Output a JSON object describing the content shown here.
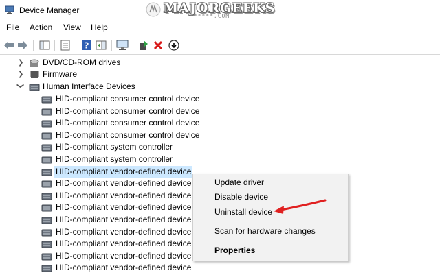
{
  "window": {
    "title": "Device Manager"
  },
  "watermark": {
    "text": "MAJORGEEKS",
    "sub": "******.COM"
  },
  "menu": [
    {
      "label": "File"
    },
    {
      "label": "Action"
    },
    {
      "label": "View"
    },
    {
      "label": "Help"
    }
  ],
  "tree": {
    "categories": [
      {
        "label": "DVD/CD-ROM drives",
        "icon": "dvd-drive-icon",
        "expanded": false
      },
      {
        "label": "Firmware",
        "icon": "firmware-icon",
        "expanded": false
      },
      {
        "label": "Human Interface Devices",
        "icon": "hid-category-icon",
        "expanded": true
      }
    ],
    "devices": [
      {
        "label": "HID-compliant consumer control device"
      },
      {
        "label": "HID-compliant consumer control device"
      },
      {
        "label": "HID-compliant consumer control device"
      },
      {
        "label": "HID-compliant consumer control device"
      },
      {
        "label": "HID-compliant system controller"
      },
      {
        "label": "HID-compliant system controller"
      },
      {
        "label": "HID-compliant vendor-defined device",
        "selected": true
      },
      {
        "label": "HID-compliant vendor-defined device"
      },
      {
        "label": "HID-compliant vendor-defined device"
      },
      {
        "label": "HID-compliant vendor-defined device"
      },
      {
        "label": "HID-compliant vendor-defined device"
      },
      {
        "label": "HID-compliant vendor-defined device"
      },
      {
        "label": "HID-compliant vendor-defined device"
      },
      {
        "label": "HID-compliant vendor-defined device"
      },
      {
        "label": "HID-compliant vendor-defined device"
      }
    ]
  },
  "context_menu": {
    "items": [
      {
        "label": "Update driver"
      },
      {
        "label": "Disable device"
      },
      {
        "label": "Uninstall device"
      },
      {
        "label": "Scan for hardware changes"
      },
      {
        "label": "Properties",
        "bold": true
      }
    ]
  },
  "colors": {
    "selection": "#cce8ff",
    "accent_arrow": "#e02020",
    "menu_bg": "#f2f2f2"
  }
}
